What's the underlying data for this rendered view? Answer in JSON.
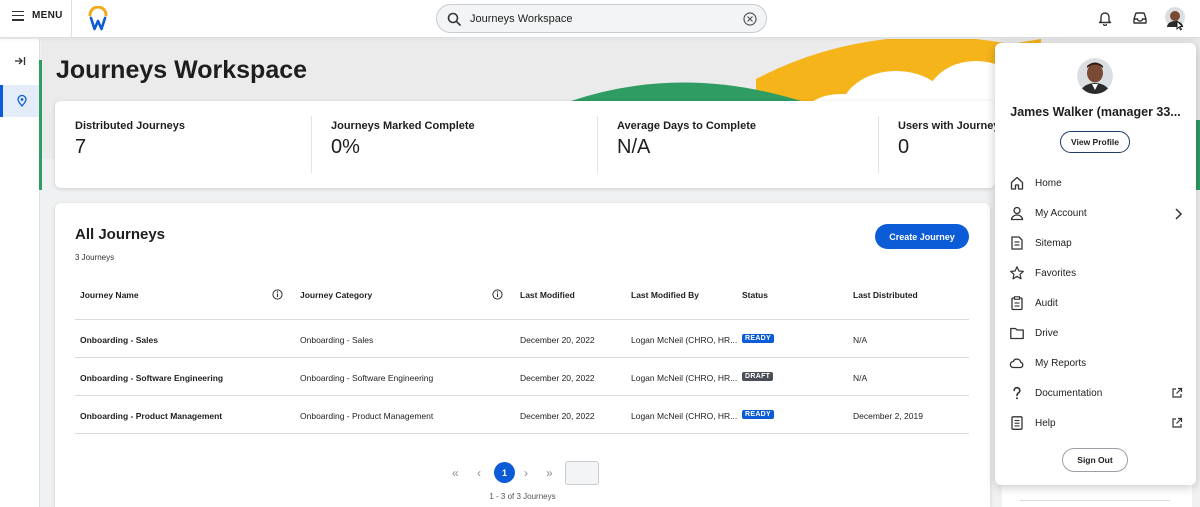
{
  "topbar": {
    "menu_label": "MENU",
    "search_value": "Journeys Workspace"
  },
  "page": {
    "title": "Journeys Workspace"
  },
  "metrics": [
    {
      "label": "Distributed Journeys",
      "value": "7"
    },
    {
      "label": "Journeys Marked Complete",
      "value": "0%"
    },
    {
      "label": "Average Days to Complete",
      "value": "N/A"
    },
    {
      "label": "Users with Journeys in",
      "value": "0"
    }
  ],
  "journeys": {
    "title": "All Journeys",
    "count": "3 Journeys",
    "create_label": "Create Journey",
    "columns": [
      "Journey Name",
      "Journey Category",
      "Last Modified",
      "Last Modified By",
      "Status",
      "Last Distributed"
    ],
    "rows": [
      {
        "name": "Onboarding - Sales",
        "category": "Onboarding - Sales",
        "modified": "December 20, 2022",
        "modified_by": "Logan McNeil (CHRO, HR...",
        "status": "READY",
        "distributed": "N/A"
      },
      {
        "name": "Onboarding - Software Engineering",
        "category": "Onboarding - Software Engineering",
        "modified": "December 20, 2022",
        "modified_by": "Logan McNeil (CHRO, HR...",
        "status": "DRAFT",
        "distributed": "N/A"
      },
      {
        "name": "Onboarding - Product Management",
        "category": "Onboarding - Product Management",
        "modified": "December 20, 2022",
        "modified_by": "Logan McNeil (CHRO, HR...",
        "status": "READY",
        "distributed": "December 2, 2019"
      }
    ],
    "pager": {
      "current_page": "1",
      "summary": "1 - 3 of 3 Journeys"
    }
  },
  "profile": {
    "name": "James Walker (manager 33...",
    "view_profile_label": "View Profile",
    "menu": [
      {
        "label": "Home",
        "icon": "home-icon"
      },
      {
        "label": "My Account",
        "icon": "person-icon"
      },
      {
        "label": "Sitemap",
        "icon": "sitemap-icon"
      },
      {
        "label": "Favorites",
        "icon": "star-icon"
      },
      {
        "label": "Audit",
        "icon": "clipboard-icon"
      },
      {
        "label": "Drive",
        "icon": "folder-icon"
      },
      {
        "label": "My Reports",
        "icon": "cloud-icon"
      },
      {
        "label": "Documentation",
        "icon": "question-icon"
      },
      {
        "label": "Help",
        "icon": "help-doc-icon"
      }
    ],
    "sign_out_label": "Sign Out"
  },
  "colors": {
    "accent": "#0b5cd6",
    "banner_yellow": "#f5b41a",
    "banner_green": "#2e9c63",
    "draft_badge": "#4a4f55"
  }
}
